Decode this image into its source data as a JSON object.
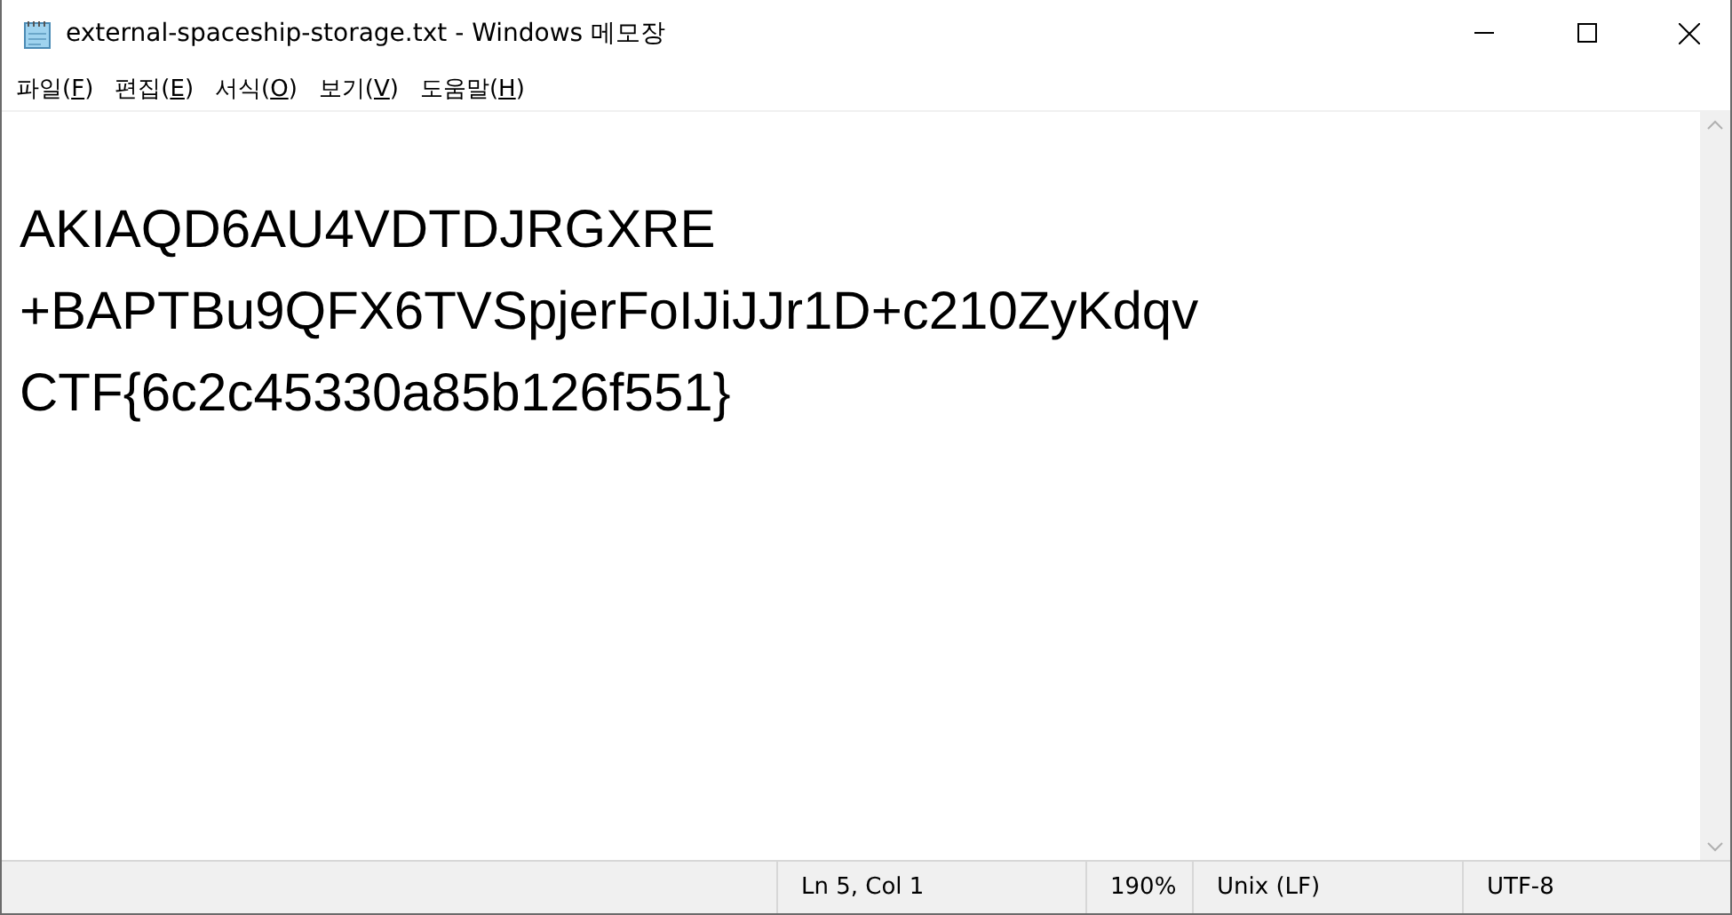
{
  "window": {
    "title": "external-spaceship-storage.txt - Windows 메모장"
  },
  "menu": [
    {
      "text_before": "파일(",
      "access_key": "F",
      "text_after": ")"
    },
    {
      "text_before": "편집(",
      "access_key": "E",
      "text_after": ")"
    },
    {
      "text_before": "서식(",
      "access_key": "O",
      "text_after": ")"
    },
    {
      "text_before": "보기(",
      "access_key": "V",
      "text_after": ")"
    },
    {
      "text_before": "도움말(",
      "access_key": "H",
      "text_after": ")"
    }
  ],
  "editor": {
    "lines": [
      "AKIAQD6AU4VDTDJRGXRE",
      "+BAPTBu9QFX6TVSpjerFoIJiJJr1D+c210ZyKdqv",
      "CTF{6c2c45330a85b126f551}"
    ]
  },
  "status_bar": {
    "position": "Ln 5, Col 1",
    "zoom": "190%",
    "line_ending": "Unix (LF)",
    "encoding": "UTF-8"
  }
}
